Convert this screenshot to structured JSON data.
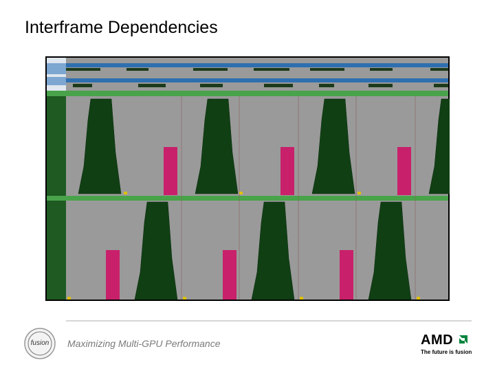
{
  "slide": {
    "title": "Interframe Dependencies",
    "footer_text": "Maximizing Multi-GPU Performance"
  },
  "screenshot": {
    "description_icon": "gpu-timeline-trace",
    "colors": {
      "frame": "#000000",
      "track_bg": "#9a9a9a",
      "header_blue": "#2e6fb0",
      "lane_green": "#49a34a",
      "sidebar_green": "#1f5a22",
      "work_dark": "#103f14",
      "work_pink": "#c8206a",
      "marker_yellow": "#e0c000"
    }
  },
  "branding": {
    "fusion_logo_word": "fusion",
    "amd_word": "AMD",
    "amd_tagline": "The future is fusion",
    "amd_arrow_color": "#00843d"
  }
}
